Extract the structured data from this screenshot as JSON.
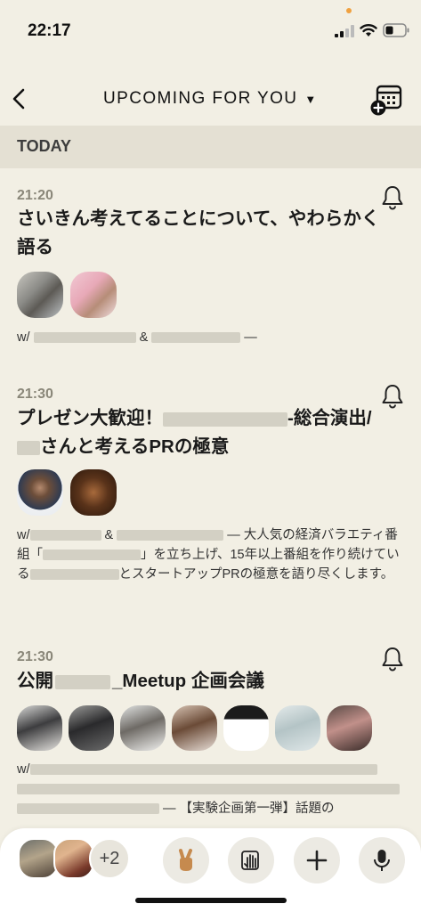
{
  "status_bar": {
    "time": "22:17"
  },
  "header": {
    "title": "UPCOMING FOR YOU",
    "dropdown_arrow": "▼"
  },
  "section": {
    "label": "TODAY"
  },
  "events": [
    {
      "time": "21:20",
      "title": "さいきん考えてることについて、やわらかく語る",
      "desc_prefix": "w/",
      "desc_mid": "&",
      "desc_suffix": "—"
    },
    {
      "time": "21:30",
      "title_a": "プレゼン大歓迎！",
      "title_b": "-総合演出/",
      "title_c": "さんと考えるPRの極意",
      "desc_prefix": "w/",
      "desc_mid": "&",
      "desc_text_1": "— 大人気の経済バラエティ番組「",
      "desc_text_2": "」を立ち上げ、15年以上番組を作り続けている",
      "desc_text_3": "とスタートアップPRの極意を語り尽くします。"
    },
    {
      "time": "21:30",
      "title_a": "公開",
      "title_b": "_Meetup 企画会議",
      "desc_prefix": "w/",
      "desc_text_1": "— 【実験企画第一弾】話題の"
    }
  ],
  "bottom_bar": {
    "extra_count": "+2"
  },
  "icons": {
    "back": "chevron-left-icon",
    "calendar": "calendar-add-icon",
    "bell": "bell-icon",
    "peace": "peace-hand-icon",
    "raise_hand": "raise-hand-icon",
    "add": "plus-icon",
    "mic": "microphone-icon"
  },
  "colors": {
    "background": "#f2efe4",
    "band": "#e4e0d3",
    "muted": "#8a8779"
  }
}
